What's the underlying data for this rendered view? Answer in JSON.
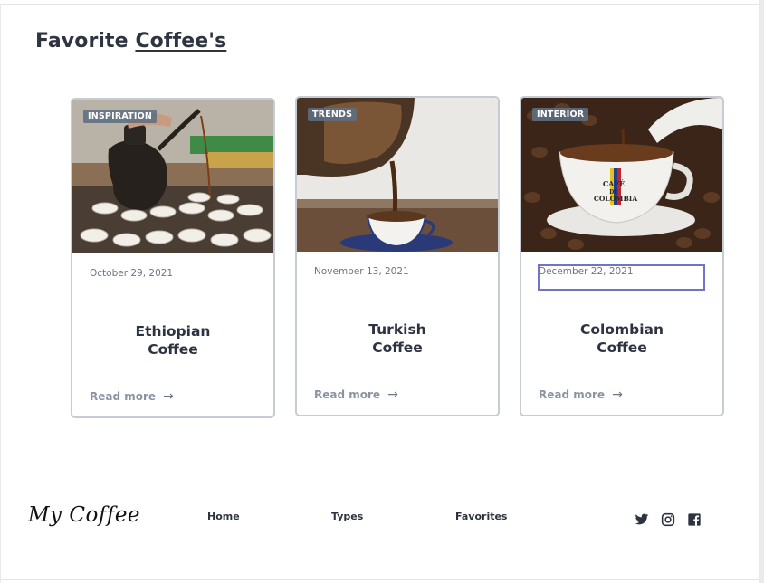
{
  "page": {
    "title_part1": "Favorite ",
    "title_part2": "Coffee's"
  },
  "cards": [
    {
      "tag": "INSPIRATION",
      "date": "October 29, 2021",
      "title_line1": "Ethiopian",
      "title_line2": "Coffee",
      "read_more": "Read more",
      "arrow": "→"
    },
    {
      "tag": "TRENDS",
      "date": "November 13, 2021",
      "title_line1": "Turkish",
      "title_line2": "Coffee",
      "read_more": "Read more",
      "arrow": "→"
    },
    {
      "tag": "INTERIOR",
      "date": "December 22, 2021",
      "title_line1": "Colombian",
      "title_line2": "Coffee",
      "read_more": "Read more",
      "arrow": "→"
    }
  ],
  "cup_text": {
    "line1": "CAFÉ",
    "line2": "DE",
    "line3": "COLOMBIA"
  },
  "footer": {
    "brand": "My Coffee",
    "nav": [
      "Home",
      "Types",
      "Favorites"
    ],
    "social_icons": [
      "twitter-icon",
      "instagram-icon",
      "facebook-icon"
    ]
  },
  "colors": {
    "text": "#2d3340",
    "muted": "#8a93a3",
    "card_border": "#c6ccd6",
    "focus": "#6f74c7"
  }
}
